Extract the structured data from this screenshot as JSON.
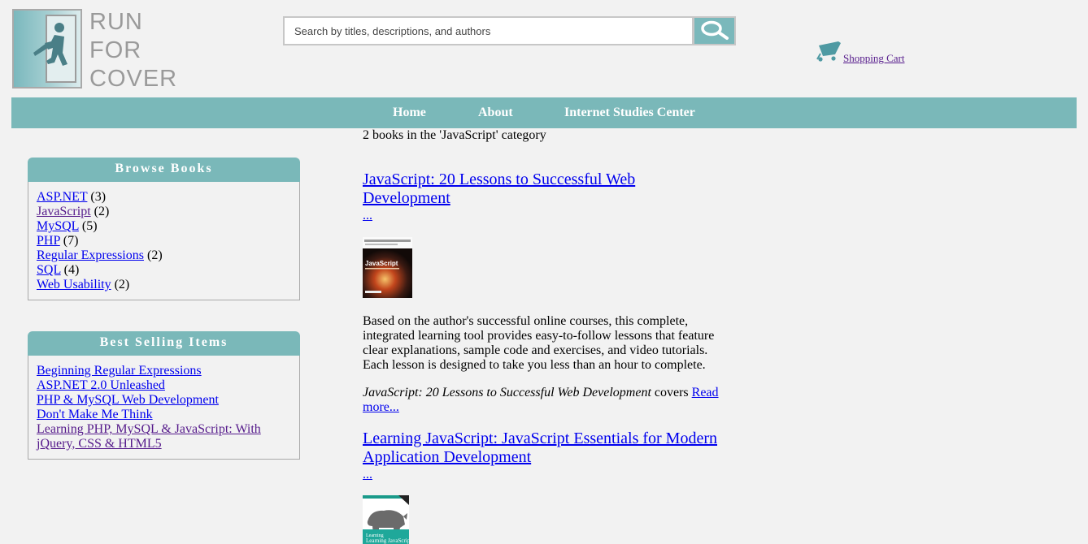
{
  "logo": {
    "lines": [
      "RUN",
      "FOR",
      "COVER"
    ]
  },
  "search": {
    "placeholder": "Search by titles, descriptions, and authors"
  },
  "cart": {
    "label": "Shopping Cart"
  },
  "nav": {
    "items": [
      "Home",
      "About",
      "Internet Studies Center"
    ]
  },
  "browse": {
    "title": "Browse Books",
    "items": [
      {
        "label": "ASP.NET",
        "count": "(3)"
      },
      {
        "label": "JavaScript",
        "count": "(2)"
      },
      {
        "label": "MySQL",
        "count": "(5)"
      },
      {
        "label": "PHP",
        "count": "(7)"
      },
      {
        "label": "Regular Expressions",
        "count": "(2)"
      },
      {
        "label": "SQL",
        "count": "(4)"
      },
      {
        "label": "Web Usability",
        "count": "(2)"
      }
    ]
  },
  "bestsellers": {
    "title": "Best Selling Items",
    "items": [
      "Beginning Regular Expressions",
      "ASP.NET 2.0 Unleashed",
      "PHP & MySQL Web Development",
      "Don't Make Me Think",
      "Learning PHP, MySQL & JavaScript: With jQuery, CSS & HTML5"
    ]
  },
  "main": {
    "count_text": "2 books in the 'JavaScript' category",
    "books": [
      {
        "title": "JavaScript: 20 Lessons to Successful Web Development",
        "ellipsis": "...",
        "cover_title": "JavaScript",
        "description": "Based on the author's successful online courses, this complete, integrated learning tool provides easy-to-follow lessons that feature clear explanations, sample code and exercises, and video tutorials. Each lesson is designed to take you less than an hour to complete.",
        "covers_italic": "JavaScript: 20 Lessons to Successful Web Development",
        "covers_word": " covers ",
        "read_more": "Read more..."
      },
      {
        "title": "Learning JavaScript: JavaScript Essentials for Modern Application Development",
        "ellipsis": "...",
        "cover_title": "Learning JavaScript"
      }
    ]
  },
  "colors": {
    "accent": "#7ab8b9",
    "background": "#f2f2f2"
  }
}
